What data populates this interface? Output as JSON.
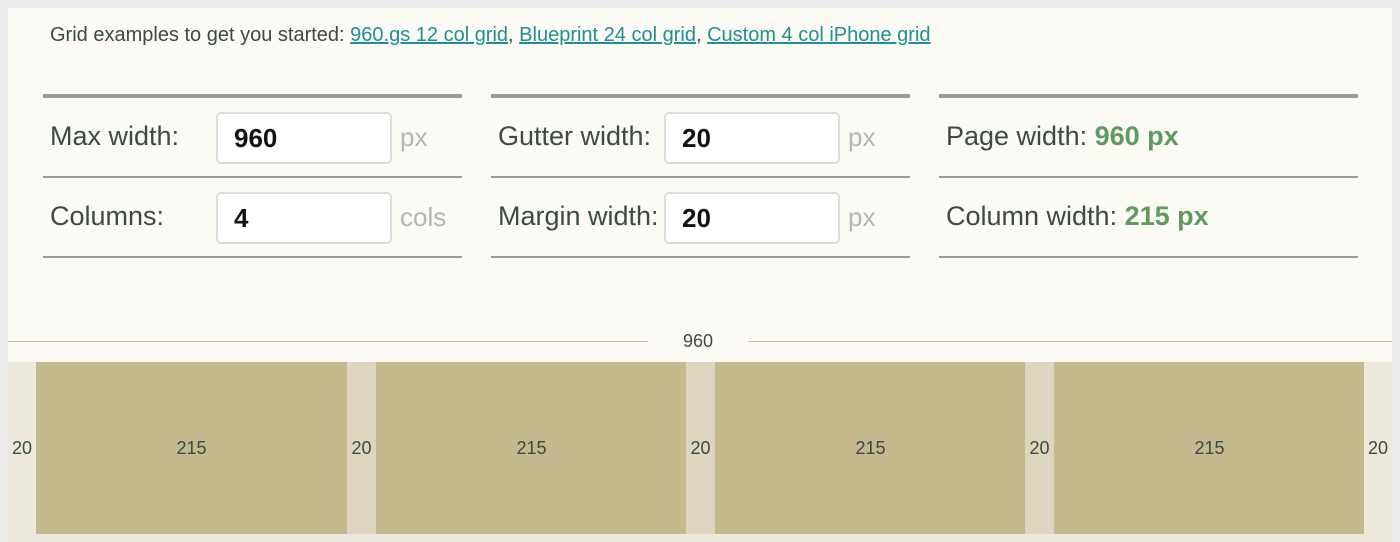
{
  "intro": {
    "text": "Grid examples to get you started:",
    "links": [
      "960.gs 12 col grid",
      "Blueprint 24 col grid",
      "Custom 4 col iPhone grid"
    ]
  },
  "settings": {
    "max_width": {
      "label": "Max width:",
      "value": "960",
      "unit": "px"
    },
    "columns": {
      "label": "Columns:",
      "value": "4",
      "unit": "cols"
    },
    "gutter_width": {
      "label": "Gutter width:",
      "value": "20",
      "unit": "px"
    },
    "margin_width": {
      "label": "Margin width:",
      "value": "20",
      "unit": "px"
    }
  },
  "results": {
    "page_width": {
      "label": "Page width:",
      "value": "960 px"
    },
    "column_width": {
      "label": "Column width:",
      "value": "215 px"
    }
  },
  "preview": {
    "total": "960",
    "margin_left": "20",
    "margin_right": "20",
    "gutters": [
      "20",
      "20",
      "20"
    ],
    "columns": [
      "215",
      "215",
      "215",
      "215"
    ]
  },
  "colors": {
    "link": "#1f8f96",
    "result_value": "#5f9b5f",
    "column": "#c5ba8e",
    "gutter": "#ddd5bd",
    "margin": "#ece8dc"
  }
}
